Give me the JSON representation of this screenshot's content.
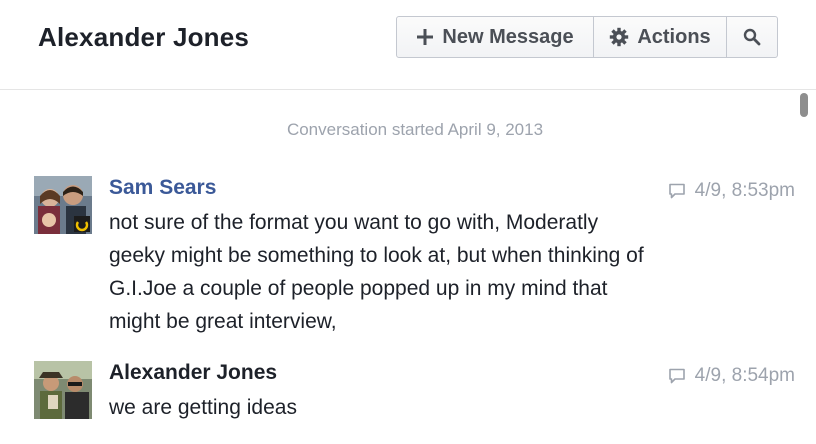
{
  "header": {
    "title": "Alexander Jones",
    "new_message_label": "New Message",
    "actions_label": "Actions"
  },
  "conversation": {
    "started_text": "Conversation started April 9, 2013",
    "messages": [
      {
        "sender": "Sam Sears",
        "timestamp": "4/9, 8:53pm",
        "lines": [
          "not sure of the format you want to go with, Moderatly",
          "geeky might be something to look at, but when thinking of",
          "G.I.Joe a couple of people popped up in my mind that",
          "might be great interview,"
        ]
      },
      {
        "sender": "Alexander Jones",
        "timestamp": "4/9, 8:54pm",
        "lines": [
          "we are getting ideas"
        ]
      }
    ]
  },
  "colors": {
    "link_blue": "#3b5998",
    "muted_gray": "#9da3ad",
    "text_dark": "#1d2129"
  },
  "icons": {
    "new_message": "plus-icon",
    "actions": "gear-icon",
    "search": "search-icon",
    "timestamp": "speech-bubble-icon"
  }
}
